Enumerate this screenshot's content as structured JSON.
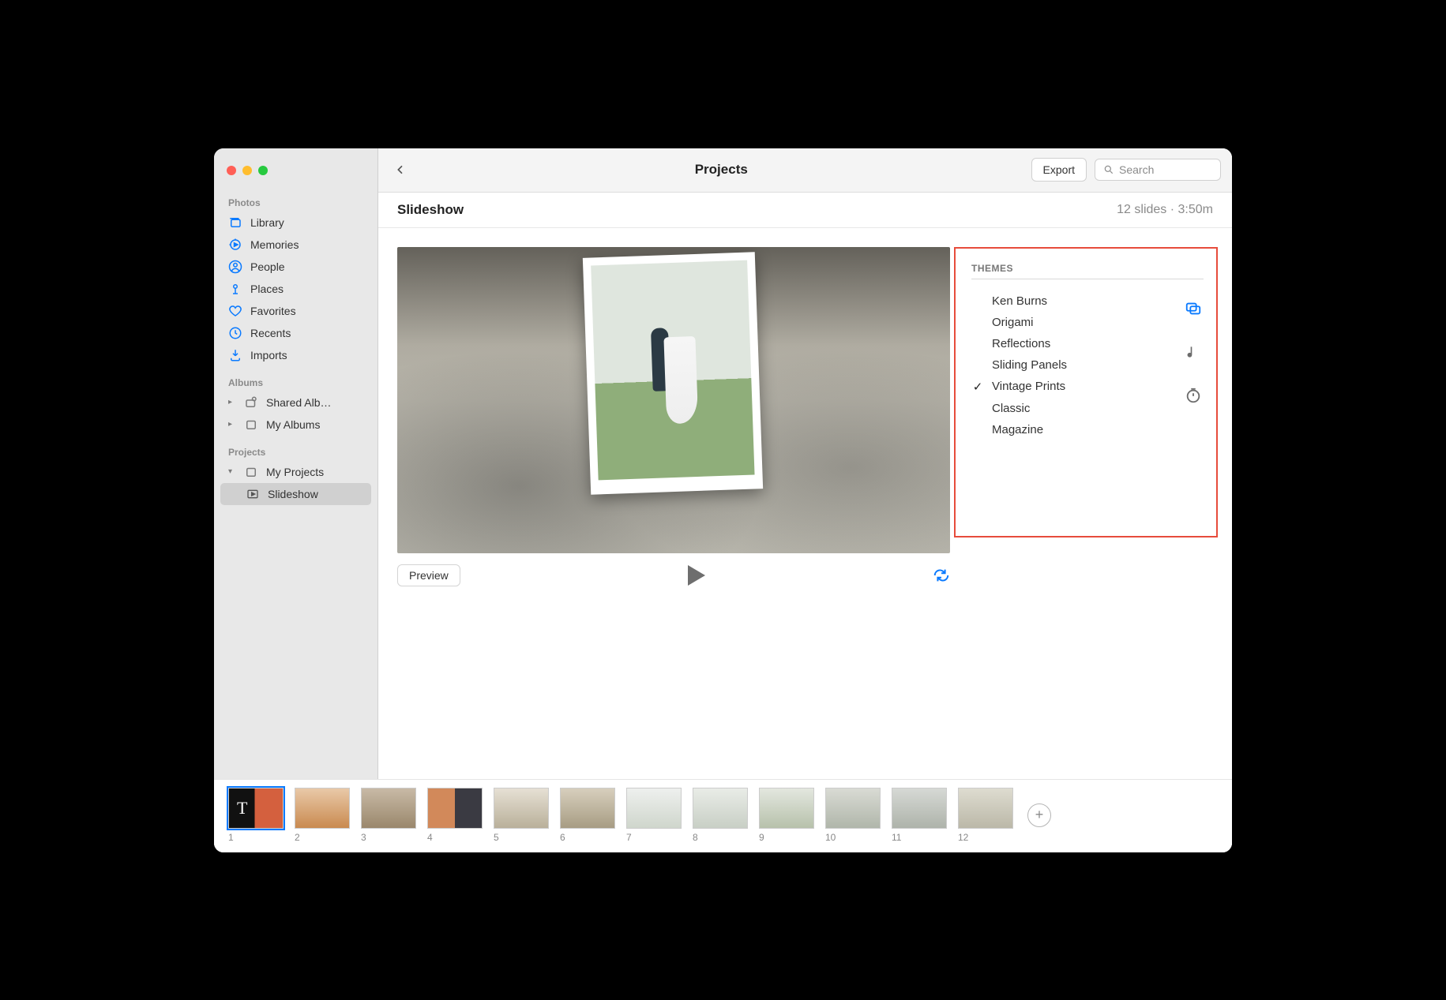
{
  "toolbar": {
    "title": "Projects",
    "export_label": "Export",
    "search_placeholder": "Search"
  },
  "subheader": {
    "name": "Slideshow",
    "meta": "12 slides · 3:50m"
  },
  "sidebar": {
    "section_photos": "Photos",
    "section_albums": "Albums",
    "section_projects": "Projects",
    "items": {
      "library": "Library",
      "memories": "Memories",
      "people": "People",
      "places": "Places",
      "favorites": "Favorites",
      "recents": "Recents",
      "imports": "Imports",
      "shared": "Shared Alb…",
      "my_albums": "My Albums",
      "my_projects": "My Projects",
      "slideshow": "Slideshow"
    }
  },
  "preview": {
    "button": "Preview"
  },
  "themes": {
    "heading": "THEMES",
    "items": [
      {
        "name": "Ken Burns",
        "selected": false
      },
      {
        "name": "Origami",
        "selected": false
      },
      {
        "name": "Reflections",
        "selected": false
      },
      {
        "name": "Sliding Panels",
        "selected": false
      },
      {
        "name": "Vintage Prints",
        "selected": true
      },
      {
        "name": "Classic",
        "selected": false
      },
      {
        "name": "Magazine",
        "selected": false
      }
    ]
  },
  "thumbnails": [
    {
      "num": "1"
    },
    {
      "num": "2"
    },
    {
      "num": "3"
    },
    {
      "num": "4"
    },
    {
      "num": "5"
    },
    {
      "num": "6"
    },
    {
      "num": "7"
    },
    {
      "num": "8"
    },
    {
      "num": "9"
    },
    {
      "num": "10"
    },
    {
      "num": "11"
    },
    {
      "num": "12"
    }
  ]
}
